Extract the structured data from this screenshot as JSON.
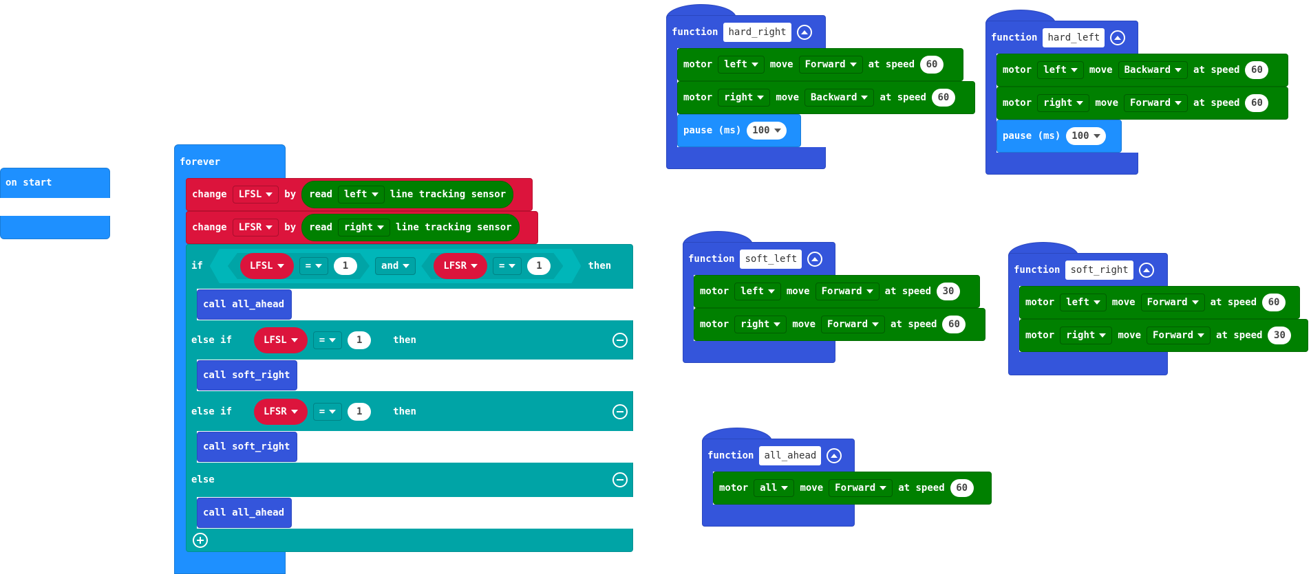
{
  "on_start": {
    "label": "on start"
  },
  "forever": {
    "label": "forever",
    "change1": {
      "kw": "change",
      "var": "LFSL",
      "by": "by",
      "read": "read",
      "side": "left",
      "sensor": "line tracking sensor"
    },
    "change2": {
      "kw": "change",
      "var": "LFSR",
      "by": "by",
      "read": "read",
      "side": "right",
      "sensor": "line tracking sensor"
    },
    "if": {
      "kw": "if",
      "a_var": "LFSL",
      "a_op": "=",
      "a_val": "1",
      "and": "and",
      "b_var": "LFSR",
      "b_op": "=",
      "b_val": "1",
      "then": "then"
    },
    "call1": "call all_ahead",
    "elseif1": {
      "kw": "else if",
      "var": "LFSL",
      "op": "=",
      "val": "1",
      "then": "then"
    },
    "call2": "call soft_right",
    "elseif2": {
      "kw": "else if",
      "var": "LFSR",
      "op": "=",
      "val": "1",
      "then": "then"
    },
    "call3": "call soft_right",
    "else": "else",
    "call4": "call all_ahead"
  },
  "functions": {
    "hard_right": {
      "kw": "function",
      "name": "hard_right",
      "m1": {
        "motor": "motor",
        "side": "left",
        "move": "move",
        "dir": "Forward",
        "at": "at speed",
        "speed": "60"
      },
      "m2": {
        "motor": "motor",
        "side": "right",
        "move": "move",
        "dir": "Backward",
        "at": "at speed",
        "speed": "60"
      },
      "pause": {
        "label": "pause (ms)",
        "val": "100"
      }
    },
    "hard_left": {
      "kw": "function",
      "name": "hard_left",
      "m1": {
        "motor": "motor",
        "side": "left",
        "move": "move",
        "dir": "Backward",
        "at": "at speed",
        "speed": "60"
      },
      "m2": {
        "motor": "motor",
        "side": "right",
        "move": "move",
        "dir": "Forward",
        "at": "at speed",
        "speed": "60"
      },
      "pause": {
        "label": "pause (ms)",
        "val": "100"
      }
    },
    "soft_left": {
      "kw": "function",
      "name": "soft_left",
      "m1": {
        "motor": "motor",
        "side": "left",
        "move": "move",
        "dir": "Forward",
        "at": "at speed",
        "speed": "30"
      },
      "m2": {
        "motor": "motor",
        "side": "right",
        "move": "move",
        "dir": "Forward",
        "at": "at speed",
        "speed": "60"
      }
    },
    "soft_right": {
      "kw": "function",
      "name": "soft_right",
      "m1": {
        "motor": "motor",
        "side": "left",
        "move": "move",
        "dir": "Forward",
        "at": "at speed",
        "speed": "60"
      },
      "m2": {
        "motor": "motor",
        "side": "right",
        "move": "move",
        "dir": "Forward",
        "at": "at speed",
        "speed": "30"
      }
    },
    "all_ahead": {
      "kw": "function",
      "name": "all_ahead",
      "m1": {
        "motor": "motor",
        "side": "all",
        "move": "move",
        "dir": "Forward",
        "at": "at speed",
        "speed": "60"
      }
    }
  },
  "colors": {
    "events": "#1e90ff",
    "variables": "#dc143c",
    "logic": "#00a4a6",
    "functions": "#3455db",
    "motor": "#008000",
    "basic": "#1e90ff"
  },
  "icons": {
    "collapse": "chevron-up-icon",
    "remove": "minus-circle-icon",
    "add": "plus-circle-icon"
  }
}
